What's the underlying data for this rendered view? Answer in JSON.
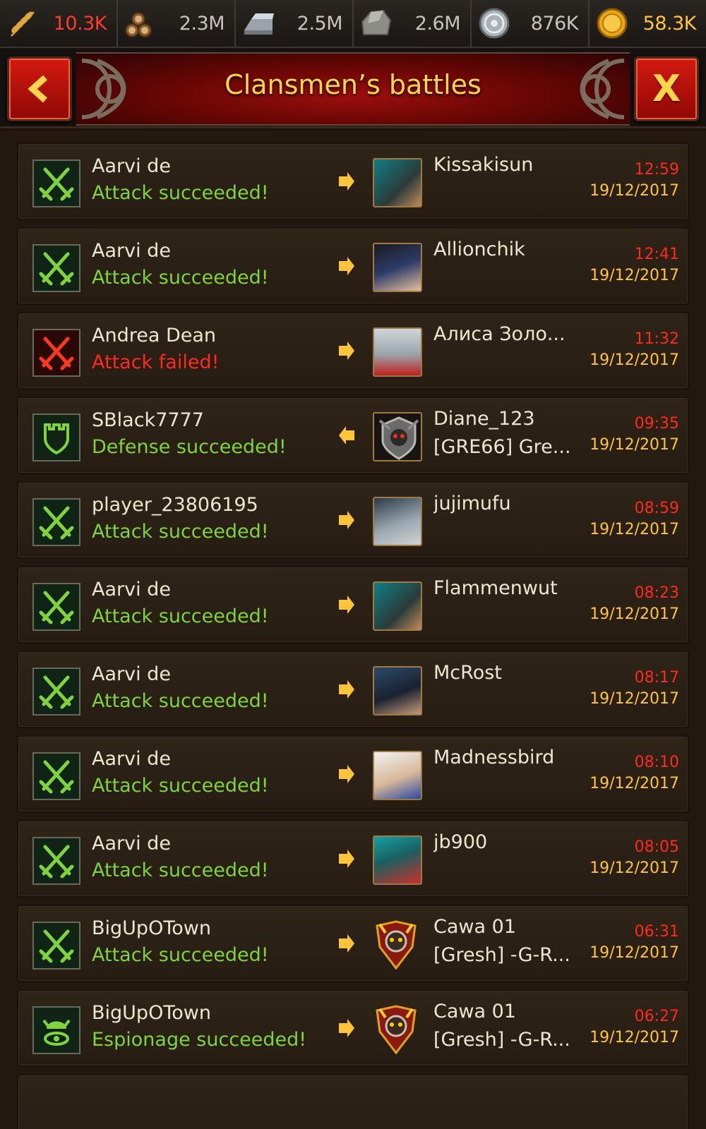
{
  "resources": [
    {
      "icon": "wheat-icon",
      "value": "10.3K",
      "tone": "red"
    },
    {
      "icon": "wood-logs-icon",
      "value": "2.3M",
      "tone": "normal"
    },
    {
      "icon": "iron-ingot-icon",
      "value": "2.5M",
      "tone": "normal"
    },
    {
      "icon": "stone-icon",
      "value": "2.6M",
      "tone": "normal"
    },
    {
      "icon": "silver-coin-icon",
      "value": "876K",
      "tone": "normal"
    },
    {
      "icon": "gold-coin-icon",
      "value": "58.3K",
      "tone": "gold"
    }
  ],
  "header": {
    "title": "Clansmen’s battles",
    "back_icon": "chevron-left-icon",
    "close_label": "X"
  },
  "colors": {
    "success": "#7ed43a",
    "fail": "#ff2a1a",
    "time": "#ff2a1a",
    "date": "#ffc43a",
    "name": "#efe6d2"
  },
  "battles": [
    {
      "type": "attack-ok",
      "player": "Aarvi de",
      "result": "Attack succeeded!",
      "direction": "right",
      "opponent": "Kissakisun",
      "opponent_clan": "",
      "time": "12:59",
      "date": "19/12/2017"
    },
    {
      "type": "attack-ok",
      "player": "Aarvi de",
      "result": "Attack succeeded!",
      "direction": "right",
      "opponent": "Allionchik",
      "opponent_clan": "",
      "time": "12:41",
      "date": "19/12/2017"
    },
    {
      "type": "attack-fail",
      "player": "Andrea Dean",
      "result": "Attack failed!",
      "direction": "right",
      "opponent": "Алиса Золо...",
      "opponent_clan": "",
      "time": "11:32",
      "date": "19/12/2017"
    },
    {
      "type": "defense-ok",
      "player": "SBlack7777",
      "result": "Defense succeeded!",
      "direction": "left",
      "opponent": "Diane_123",
      "opponent_clan": "[GRE66] Gre...",
      "time": "09:35",
      "date": "19/12/2017"
    },
    {
      "type": "attack-ok",
      "player": "player_23806195",
      "result": "Attack succeeded!",
      "direction": "right",
      "opponent": "jujimufu",
      "opponent_clan": "",
      "time": "08:59",
      "date": "19/12/2017"
    },
    {
      "type": "attack-ok",
      "player": "Aarvi de",
      "result": "Attack succeeded!",
      "direction": "right",
      "opponent": "Flammenwut",
      "opponent_clan": "",
      "time": "08:23",
      "date": "19/12/2017"
    },
    {
      "type": "attack-ok",
      "player": "Aarvi de",
      "result": "Attack succeeded!",
      "direction": "right",
      "opponent": "McRost",
      "opponent_clan": "",
      "time": "08:17",
      "date": "19/12/2017"
    },
    {
      "type": "attack-ok",
      "player": "Aarvi de",
      "result": "Attack succeeded!",
      "direction": "right",
      "opponent": "Madnessbird",
      "opponent_clan": "",
      "time": "08:10",
      "date": "19/12/2017"
    },
    {
      "type": "attack-ok",
      "player": "Aarvi de",
      "result": "Attack succeeded!",
      "direction": "right",
      "opponent": "jb900",
      "opponent_clan": "",
      "time": "08:05",
      "date": "19/12/2017"
    },
    {
      "type": "attack-ok",
      "player": "BigUpOTown",
      "result": "Attack succeeded!",
      "direction": "right",
      "opponent": "Cawa 01",
      "opponent_clan": "[Gresh] -G-R...",
      "time": "06:31",
      "date": "19/12/2017"
    },
    {
      "type": "espionage-ok",
      "player": "BigUpOTown",
      "result": "Espionage succeeded!",
      "direction": "right",
      "opponent": "Cawa 01",
      "opponent_clan": "[Gresh] -G-R...",
      "time": "06:27",
      "date": "19/12/2017"
    }
  ]
}
